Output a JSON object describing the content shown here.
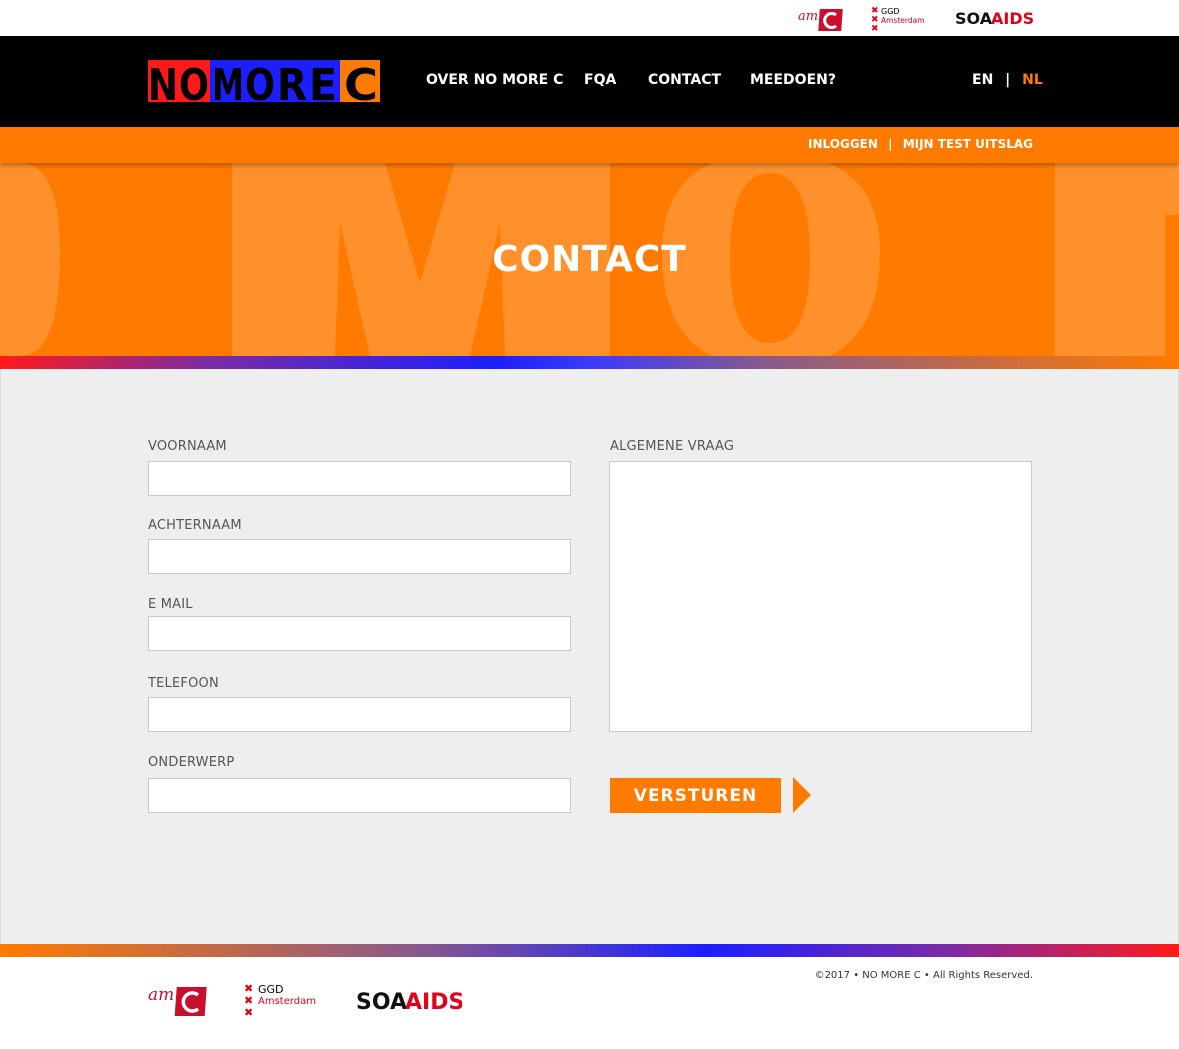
{
  "partners": {
    "amc": "am",
    "ggd_line1": "GGD",
    "ggd_line2": "Amsterdam",
    "soa_dark": "SOA",
    "soa_red": "AIDS"
  },
  "brand": {
    "letters": [
      "N",
      "O",
      "M",
      "O",
      "R",
      "E",
      "C"
    ]
  },
  "nav": {
    "items": [
      "OVER NO MORE C",
      "FQA",
      "CONTACT",
      "MEEDOEN?"
    ],
    "lang_en": "EN",
    "lang_sep": "|",
    "lang_nl": "NL"
  },
  "subnav": {
    "login": "INLOGGEN",
    "sep": "|",
    "result": "MIJN TEST UITSLAG"
  },
  "hero": {
    "title": "CONTACT",
    "watermark": "NOMORE"
  },
  "form": {
    "first_name_label": "VOORNAAM",
    "last_name_label": "ACHTERNAAM",
    "email_label": "E MAIL",
    "phone_label": "TELEFOON",
    "subject_label": "ONDERWERP",
    "question_label": "ALGEMENE VRAAG",
    "submit_label": "VERSTUREN"
  },
  "footer": {
    "copyright": "©2017 • NO MORE C  • All Rights Reserved."
  },
  "colors": {
    "accent": "#ff7a00",
    "brand_red": "#ff1a1a",
    "brand_blue": "#1b1fff",
    "nav_bg": "#000000"
  }
}
